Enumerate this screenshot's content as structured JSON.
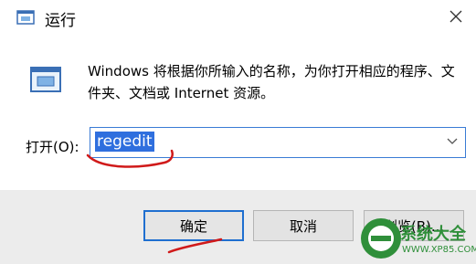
{
  "window": {
    "title": "运行",
    "icon": "run-dialog-icon",
    "close_icon": "close-icon"
  },
  "main": {
    "description": "Windows 将根据你所输入的名称，为你打开相应的程序、文件夹、文档或 Internet 资源。",
    "open_label": "打开(O):",
    "open_value": "regedit"
  },
  "buttons": {
    "ok": "确定",
    "cancel": "取消",
    "browse": "浏览(B)..."
  },
  "watermark": {
    "text": "系统大全",
    "url": "WWW.XP85.COM"
  },
  "colors": {
    "accent": "#1f6fd0",
    "selection": "#2f6fde",
    "annotation": "#d01a1a",
    "watermark": "#2f8f3a"
  }
}
